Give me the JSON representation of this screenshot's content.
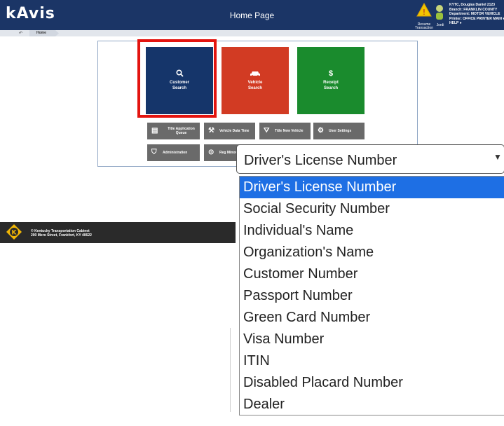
{
  "header": {
    "logo": "kAvis",
    "title": "Home Page",
    "alert_label": "Resume Transaction",
    "user_label": "Jordi",
    "user_info": [
      "KYTC, Douglas Daniel 2123",
      "Branch: FRANKLIN COUNTY",
      "Department: MOTOR VEHICLE",
      "Printer: OFFICE PRINTER MAIN ▾",
      "HELP ●"
    ]
  },
  "breadcrumbs": {
    "back": "↶",
    "home": "Home"
  },
  "tiles": [
    {
      "label1": "Customer",
      "label2": "Search",
      "icon": "search-icon",
      "glyph": "🔍"
    },
    {
      "label1": "Vehicle",
      "label2": "Search",
      "icon": "car-icon",
      "glyph": "🚗"
    },
    {
      "label1": "Receipt",
      "label2": "Search",
      "icon": "dollar-icon",
      "glyph": "$"
    }
  ],
  "small_buttons": {
    "title_app": "Title Application Queue",
    "vehicle_due": "Vehicle Data Time",
    "title_new": "Title New Vehicle",
    "user_settings": "User Settings",
    "administration": "Administration",
    "reg": "Reg Minor"
  },
  "footer": {
    "line1": "© Kentucky Transportation Cabinet",
    "line2": "200 Mero Street, Frankfort, KY 40622"
  },
  "select": {
    "value": "Driver's License Number",
    "arrow": "▼",
    "options": [
      "Driver's License Number",
      "Social Security Number",
      "Individual's Name",
      "Organization's Name",
      "Customer Number",
      "Passport Number",
      "Green Card Number",
      "Visa Number",
      "ITIN",
      "Disabled Placard Number",
      "Dealer"
    ],
    "selected_index": 0
  },
  "colors": {
    "header_bg": "#1b3566",
    "customer_tile": "#15356a",
    "vehicle_tile": "#d23b23",
    "receipt_tile": "#1a8b2d",
    "highlight": "#e3140f",
    "option_selected": "#1e6fe4"
  }
}
